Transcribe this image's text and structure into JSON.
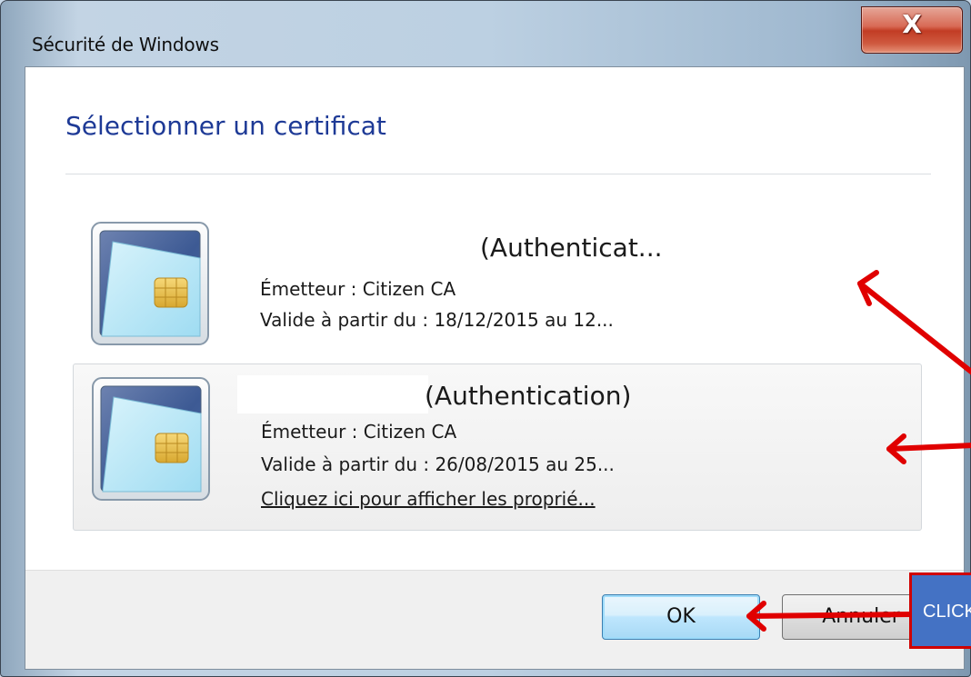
{
  "window": {
    "title": "Sécurité de Windows",
    "close_glyph": "X"
  },
  "dialog": {
    "heading": "Sélectionner un certificat",
    "certificates": [
      {
        "name": "(Authenticat...",
        "issuer": "Émetteur : Citizen CA",
        "validity": "Valide à partir du : 18/12/2015 au 12...",
        "icon": "smart-card-icon"
      },
      {
        "name": "(Authentication)",
        "issuer": "Émetteur : Citizen CA",
        "validity": "Valide à partir du : 26/08/2015 au 25...",
        "properties_link": "Cliquez ici pour afficher les proprié...",
        "icon": "smart-card-icon",
        "selected": true
      }
    ]
  },
  "buttons": {
    "ok": "OK",
    "cancel": "Annuler"
  },
  "annotation": {
    "label": "CLICK",
    "arrow_color": "#e00000",
    "box_color": "#4472c4"
  },
  "colors": {
    "heading": "#1e3a96",
    "close_button": "#c23c24"
  }
}
